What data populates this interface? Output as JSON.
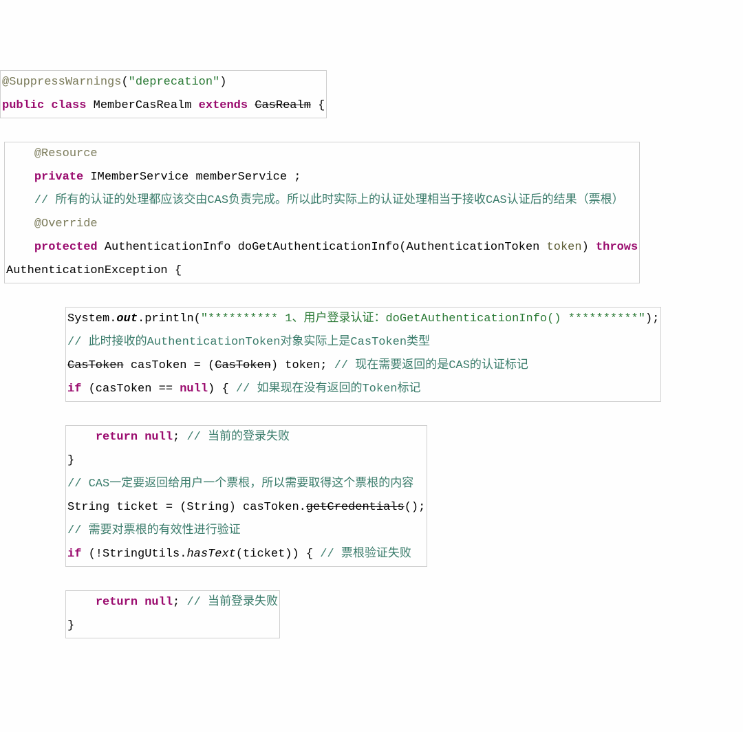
{
  "l1_anno": "@SuppressWarnings",
  "l1_paren_open": "(",
  "l1_str": "\"deprecation\"",
  "l1_paren_close": ")",
  "l2_public": "public",
  "l2_class": "class",
  "l2_name": " MemberCasRealm ",
  "l2_extends": "extends",
  "l2_sp": " ",
  "l2_cas": "CasRealm",
  "l2_brace": " {",
  "l3_resource": "@Resource",
  "l4_private": "private",
  "l4_type": " IMemberService memberService ;",
  "l5_cmt": "// 所有的认证的处理都应该交由CAS负责完成。所以此时实际上的认证处理相当于接收CAS认证后的结果（票根）",
  "l6_override": "@Override",
  "l7_protected": "protected",
  "l7_ret": " AuthenticationInfo doGetAuthenticationInfo(AuthenticationToken ",
  "l7_tok": "token",
  "l7_close": ") ",
  "l7_throws": "throws",
  "l8_exc": "AuthenticationException {",
  "l9_pre": "System.",
  "l9_out": "out",
  "l9_print": ".println(",
  "l9_str": "\"********** 1、用户登录认证：doGetAuthenticationInfo() **********\"",
  "l9_end": ");",
  "l10_cmt": "// 此时接收的AuthenticationToken对象实际上是CasToken类型",
  "l11_ct1": "CasToken",
  "l11_mid": " casToken = (",
  "l11_ct2": "CasToken",
  "l11_cast": ") token; ",
  "l11_cmt": "// 现在需要返回的是CAS的认证标记",
  "l12_if": "if",
  "l12_cond": " (casToken == ",
  "l12_null": "null",
  "l12_brace": ") { ",
  "l12_cmt": "// 如果现在没有返回的Token标记",
  "l13_return": "return",
  "l13_sp": " ",
  "l13_null": "null",
  "l13_semi": "; ",
  "l13_cmt": "// 当前的登录失败",
  "l14_brace": "}",
  "l15_cmt": "// CAS一定要返回给用户一个票根，所以需要取得这个票根的内容",
  "l16_decl": "String ticket = (String) casToken.",
  "l16_getc": "getCredentials",
  "l16_end": "();",
  "l17_cmt": "// 需要对票根的有效性进行验证",
  "l18_if": "if",
  "l18_open": " (!StringUtils.",
  "l18_ht": "hasText",
  "l18_arg": "(ticket)) { ",
  "l18_cmt": "// 票根验证失败",
  "l19_return": "return",
  "l19_sp": " ",
  "l19_null": "null",
  "l19_semi": "; ",
  "l19_cmt": "// 当前登录失败",
  "l20_brace": "}"
}
